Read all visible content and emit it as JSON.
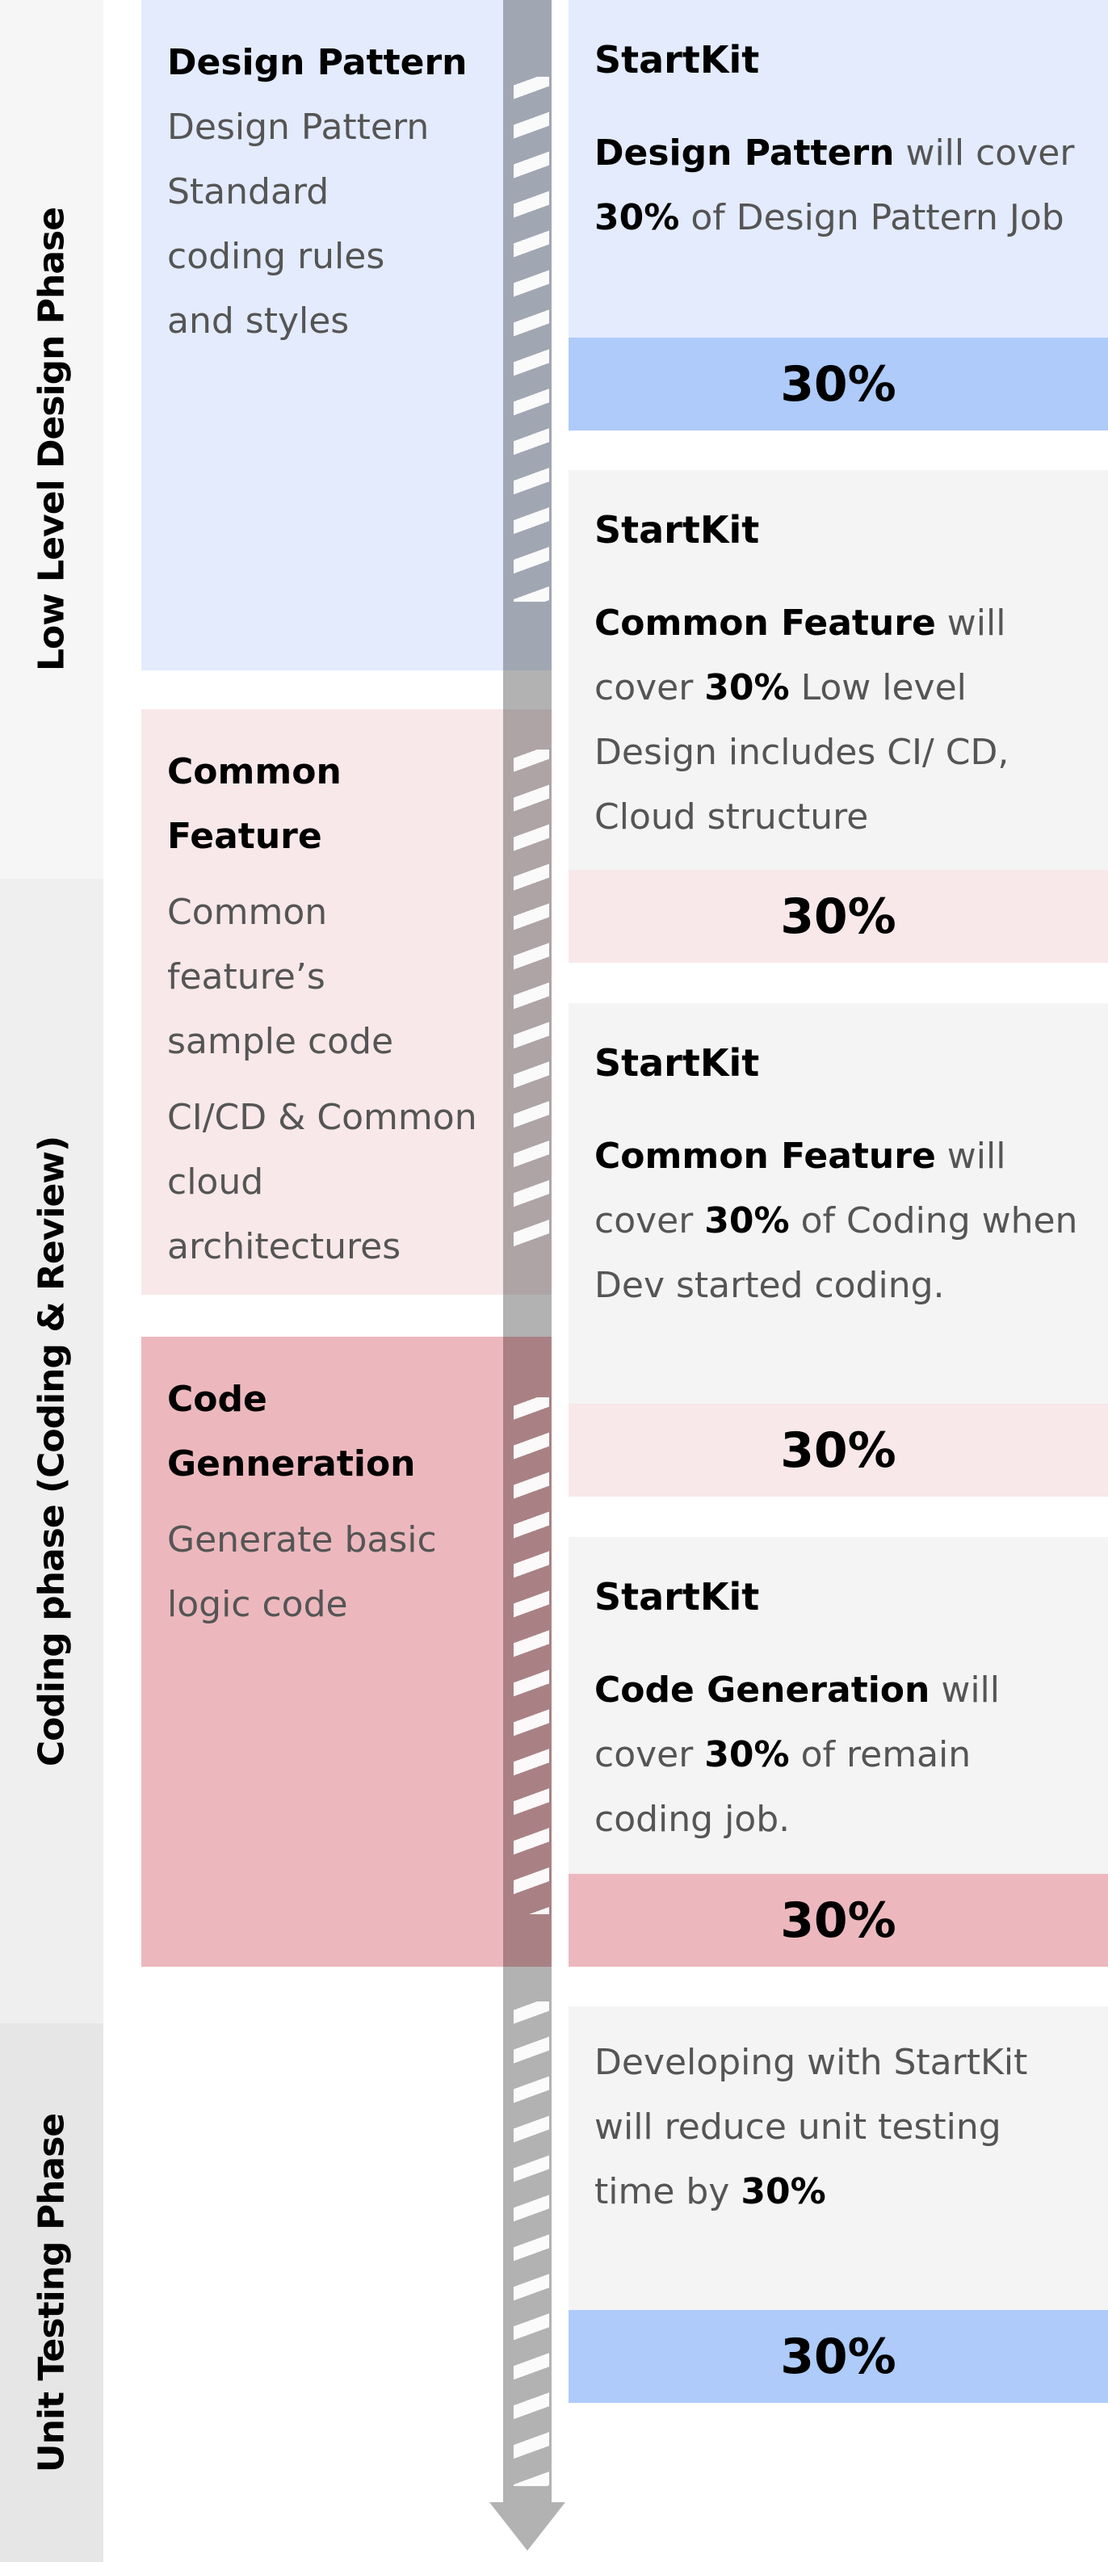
{
  "colors": {
    "phase_design_bg": "#f6f6f6",
    "phase_coding_bg": "#efefef",
    "phase_testing_bg": "#e6e6e6",
    "design_card_bg": "#e3ebfd",
    "common_card_bg": "#f8e8ea",
    "codegen_card_bg": "#ecb8be",
    "right_card_bg": "#f4f4f4",
    "blue_pct_bg": "#aecbfa",
    "light_pink_pct_bg": "#f8e8ea",
    "pink_pct_bg": "#ecb8be",
    "arrow_gray": "#b2b2b2",
    "text_gray": "#555555"
  },
  "phases": [
    {
      "label": "Low Level Design Phase"
    },
    {
      "label": "Coding phase (Coding & Review)"
    },
    {
      "label": "Unit Testing Phase"
    }
  ],
  "features": [
    {
      "title": "Design Pattern",
      "descriptions": [
        "Design Pattern",
        "Standard coding rules and styles"
      ]
    },
    {
      "title": "Common Feature",
      "descriptions": [
        "Common feature’s sample code",
        "CI/CD & Common cloud architectures"
      ]
    },
    {
      "title": "Code Genneration",
      "descriptions": [
        "Generate basic logic code"
      ]
    }
  ],
  "results": [
    {
      "kit": "StartKit",
      "bold_lead": "Design Pattern",
      "mid": " will cover ",
      "bold_pct": "30%",
      "tail": " of Design Pattern Job",
      "percent_label": "30%",
      "percent_value": 30
    },
    {
      "kit": "StartKit",
      "bold_lead": "Common Feature",
      "mid": " will cover ",
      "bold_pct": "30%",
      "tail": " Low level Design includes CI/ CD, Cloud structure",
      "percent_label": "30%",
      "percent_value": 30
    },
    {
      "kit": "StartKit",
      "bold_lead": "Common Feature",
      "mid": " will cover ",
      "bold_pct": "30%",
      "tail": " of Coding when Dev started coding.",
      "percent_label": "30%",
      "percent_value": 30
    },
    {
      "kit": "StartKit",
      "bold_lead": "Code Generation",
      "mid": " will cover ",
      "bold_pct": "30%",
      "tail": " of remain coding job.",
      "percent_label": "30%",
      "percent_value": 30
    },
    {
      "lead": "Developing with StartKit will reduce unit testing time by ",
      "bold_pct": "30%",
      "percent_label": "30%",
      "percent_value": 30
    }
  ]
}
